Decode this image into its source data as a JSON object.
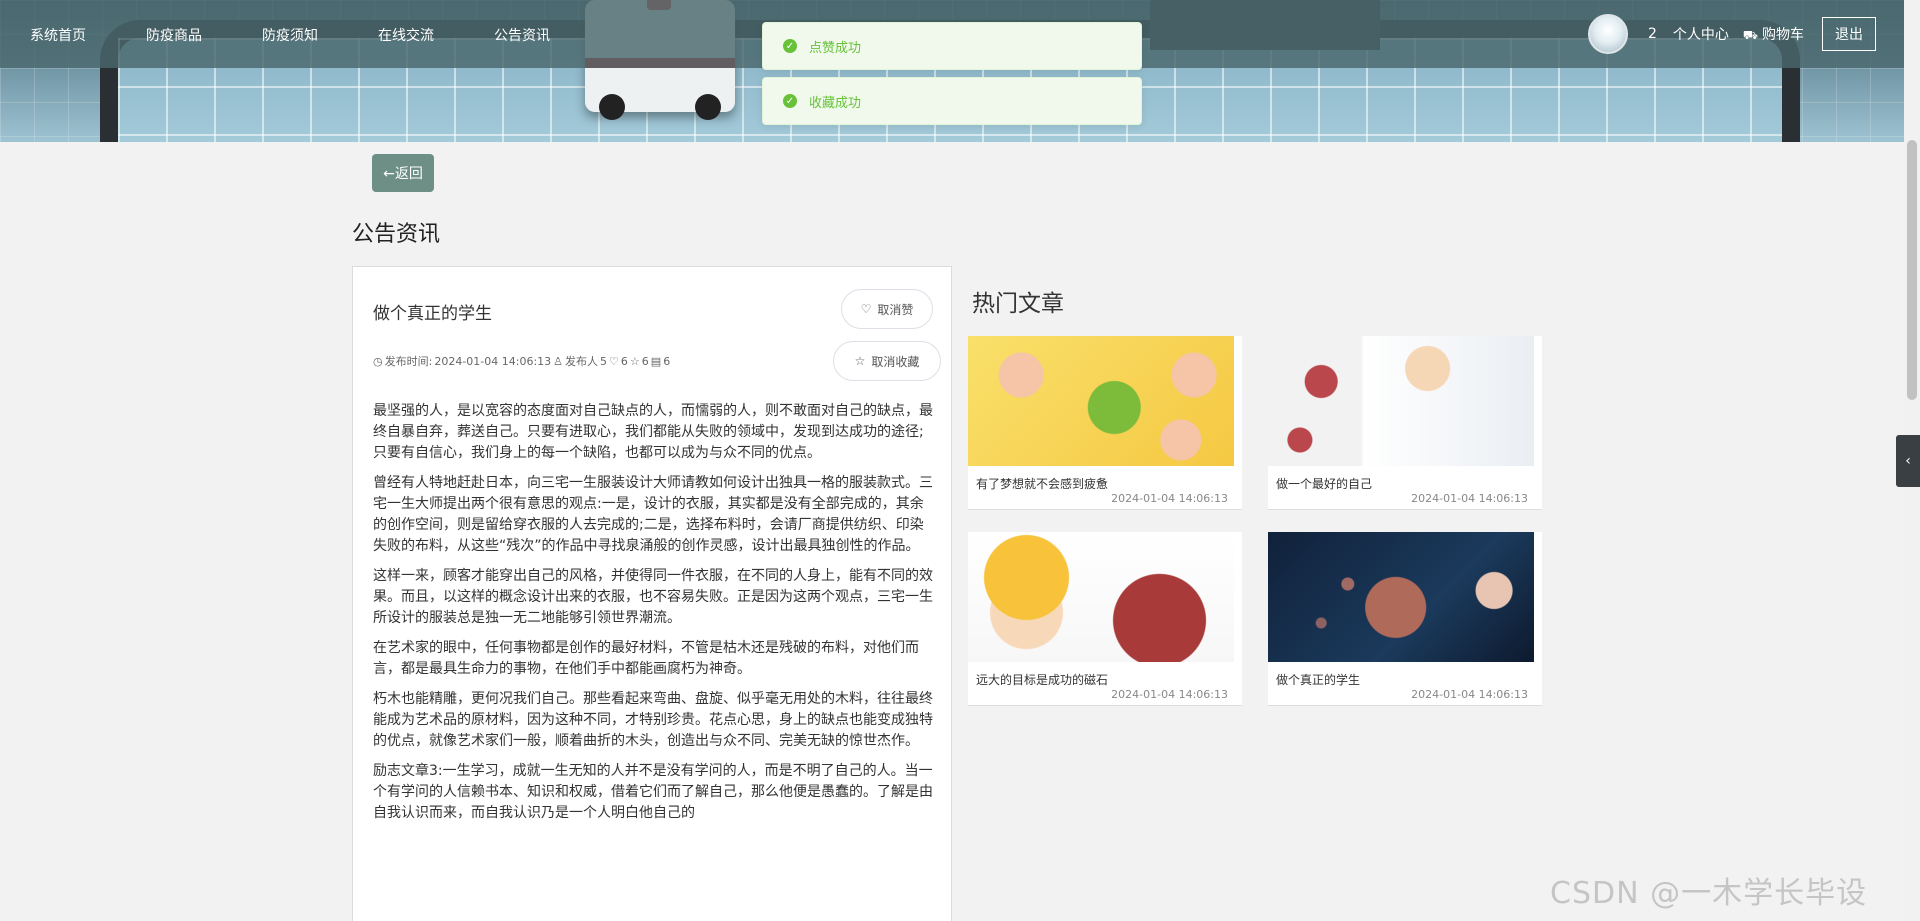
{
  "nav": {
    "items": [
      "系统首页",
      "防疫商品",
      "防疫须知",
      "在线交流",
      "公告资讯"
    ],
    "user_count": "2",
    "personal_center": "个人中心",
    "cart": "购物车",
    "logout": "退出"
  },
  "toasts": [
    "点赞成功",
    "收藏成功"
  ],
  "back_label": "←返回",
  "section_title": "公告资讯",
  "article": {
    "title": "做个真正的学生",
    "meta": {
      "publish_label": "发布时间:",
      "publish_time": "2024-01-04 14:06:13",
      "publisher_label": "发布人",
      "publisher": "5",
      "likes": "6",
      "favorites": "6",
      "comments": "6"
    },
    "unlike_label": "取消赞",
    "unfavorite_label": "取消收藏",
    "paragraphs": [
      "最坚强的人，是以宽容的态度面对自己缺点的人，而懦弱的人，则不敢面对自己的缺点，最终自暴自弃，葬送自己。只要有进取心，我们都能从失败的领域中，发现到达成功的途径;只要有自信心，我们身上的每一个缺陷，也都可以成为与众不同的优点。",
      "曾经有人特地赶赴日本，向三宅一生服装设计大师请教如何设计出独具一格的服装款式。三宅一生大师提出两个很有意思的观点:一是，设计的衣服，其实都是没有全部完成的，其余的创作空间，则是留给穿衣服的人去完成的;二是，选择布料时，会请厂商提供纺织、印染失败的布料，从这些“残次”的作品中寻找泉涌般的创作灵感，设计出最具独创性的作品。",
      "这样一来，顾客才能穿出自己的风格，并使得同一件衣服，在不同的人身上，能有不同的效果。而且，以这样的概念设计出来的衣服，也不容易失败。正是因为这两个观点，三宅一生所设计的服装总是独一无二地能够引领世界潮流。",
      "在艺术家的眼中，任何事物都是创作的最好材料，不管是枯木还是残破的布料，对他们而言，都是最具生命力的事物，在他们手中都能画腐朽为神奇。",
      "朽木也能精雕，更何况我们自己。那些看起来弯曲、盘旋、似乎毫无用处的木料，往往最终能成为艺术品的原材料，因为这种不同，才特别珍贵。花点心思，身上的缺点也能变成独特的优点，就像艺术家们一般，顺着曲折的木头，创造出与众不同、完美无缺的惊世杰作。",
      "励志文章3:一生学习，成就一生无知的人并不是没有学问的人，而是不明了自己的人。当一个有学问的人信赖书本、知识和权威，借着它们而了解自己，那么他便是愚蠢的。了解是由自我认识而来，而自我认识乃是一个人明白他自己的"
    ]
  },
  "hot": {
    "title": "热门文章",
    "cards": [
      {
        "caption": "有了梦想就不会感到疲惫",
        "time": "2024-01-04 14:06:13"
      },
      {
        "caption": "做一个最好的自己",
        "time": "2024-01-04 14:06:13"
      },
      {
        "caption": "远大的目标是成功的磁石",
        "time": "2024-01-04 14:06:13"
      },
      {
        "caption": "做个真正的学生",
        "time": "2024-01-04 14:06:13"
      }
    ]
  },
  "watermark": "CSDN @一木学长毕设",
  "colors": {
    "nav_bg": "#4a686c",
    "back_btn": "#6e8f86",
    "toast_green": "#67c23a"
  }
}
